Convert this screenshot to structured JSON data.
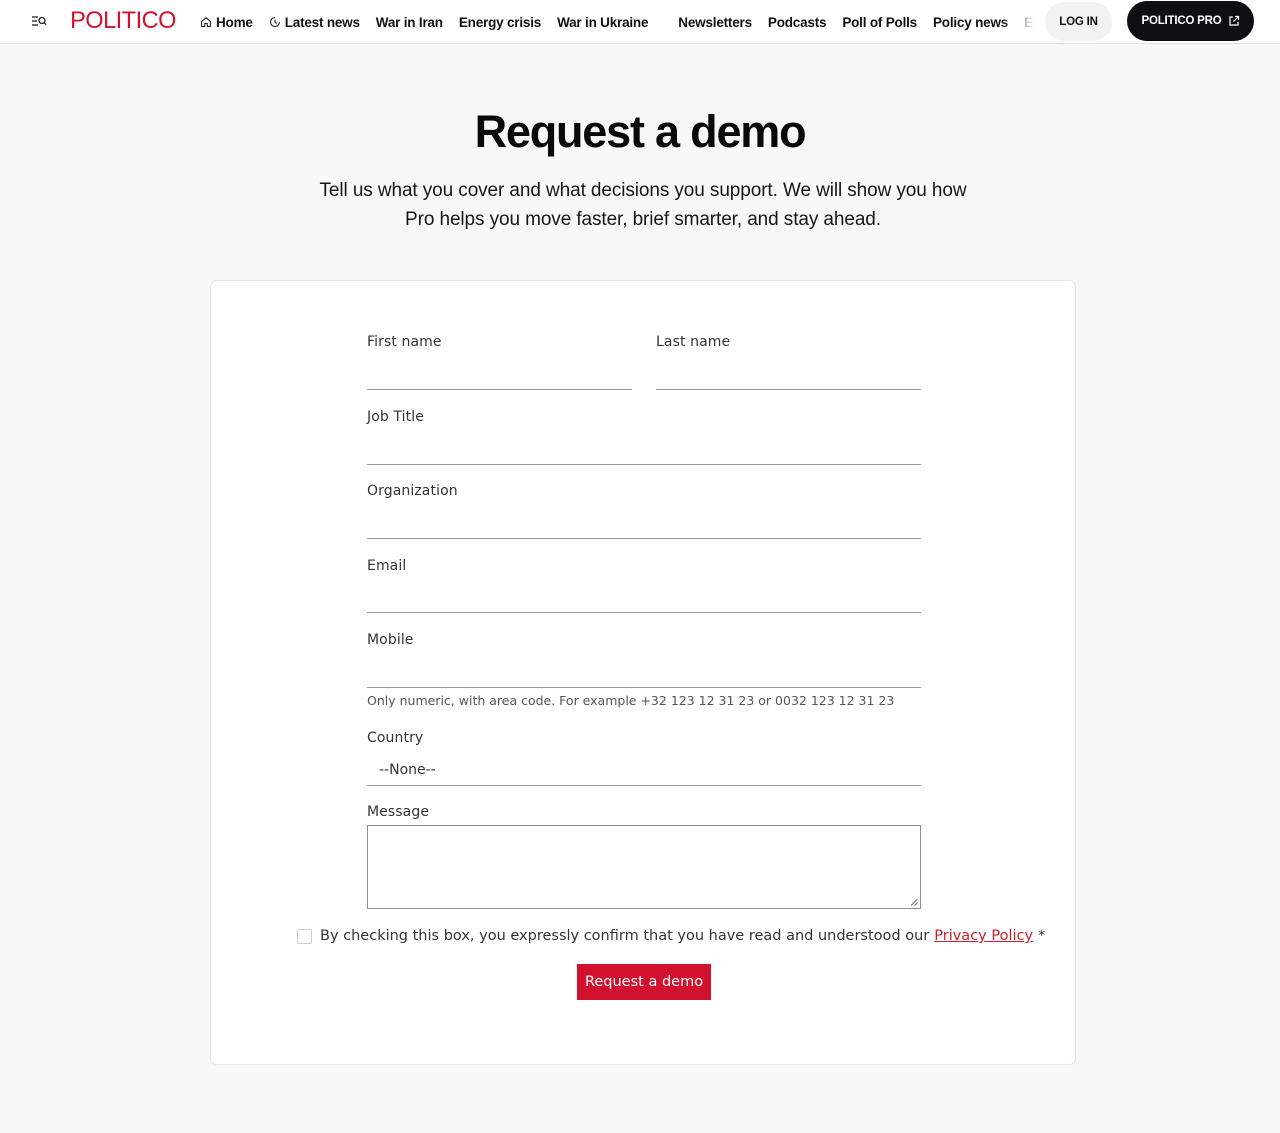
{
  "header": {
    "logo_text": "POLITICO",
    "nav_items": [
      {
        "label": "Home",
        "icon": "home-icon"
      },
      {
        "label": "Latest news",
        "icon": "clock-icon"
      },
      {
        "label": "War in Iran"
      },
      {
        "label": "Energy crisis"
      },
      {
        "label": "War in Ukraine"
      },
      {
        "label": "Newsletters"
      },
      {
        "label": "Podcasts"
      },
      {
        "label": "Poll of Polls"
      },
      {
        "label": "Policy news"
      },
      {
        "label": "Events"
      }
    ],
    "login_label": "LOG IN",
    "pro_label": "POLITICO PRO"
  },
  "hero": {
    "title": "Request a demo",
    "subtitle": "Tell us what you cover and what decisions you support. We will show you how Pro helps you move faster, brief smarter, and stay ahead."
  },
  "form": {
    "first_name": {
      "label": "First name",
      "value": ""
    },
    "last_name": {
      "label": "Last name",
      "value": ""
    },
    "job_title": {
      "label": "Job Title",
      "value": ""
    },
    "organization": {
      "label": "Organization",
      "value": ""
    },
    "email": {
      "label": "Email",
      "value": ""
    },
    "mobile": {
      "label": "Mobile",
      "value": "",
      "hint": "Only numeric, with area code. For example +32 123 12 31 23 or 0032 123 12 31 23"
    },
    "country": {
      "label": "Country",
      "selected": "--None--"
    },
    "message": {
      "label": "Message",
      "value": ""
    },
    "consent": {
      "text": "By checking this box, you expressly confirm that you have read and understood our",
      "link_text": "Privacy Policy",
      "required_mark": "*",
      "checked": false
    },
    "submit_label": "Request a demo"
  },
  "colors": {
    "brand_red": "#d2112f",
    "pro_button_bg": "#0f0f13",
    "page_bg": "#f8f8f8"
  }
}
